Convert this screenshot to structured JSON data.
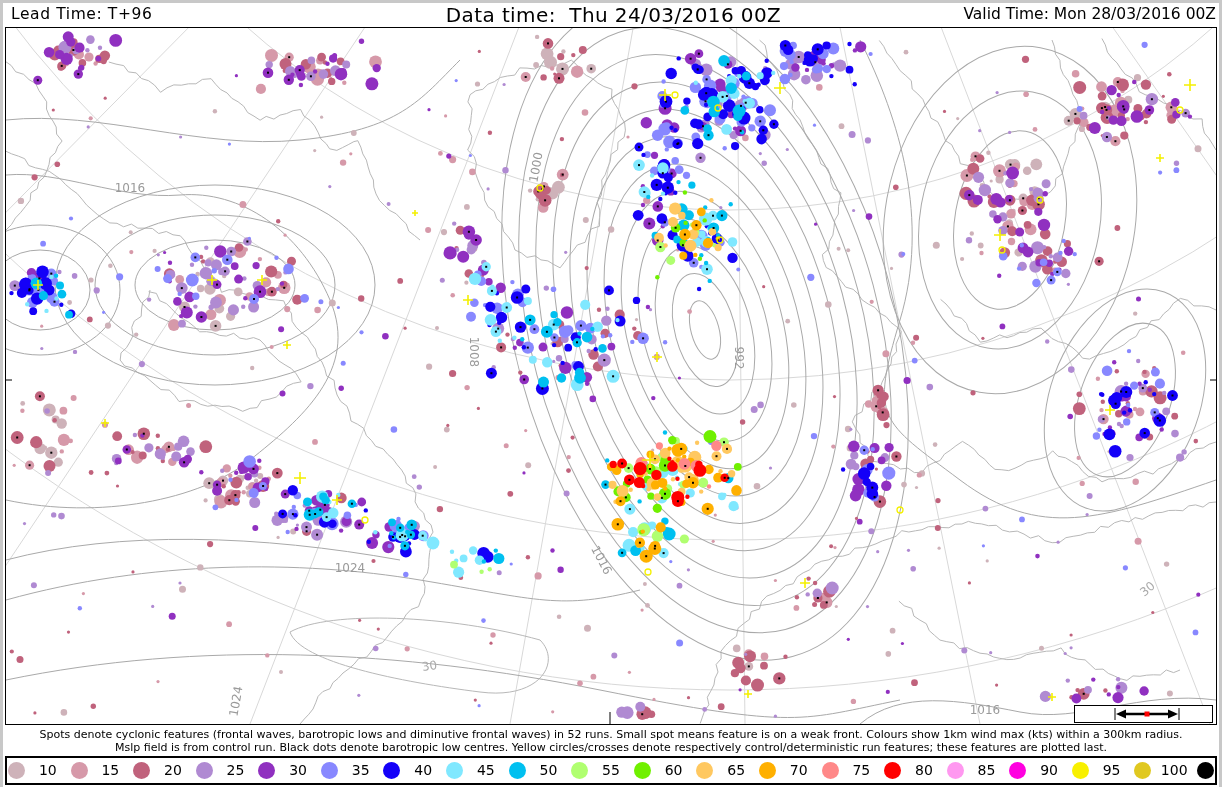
{
  "header": {
    "lead_time": "Lead Time: T+96",
    "data_time": "Data time:  Thu 24/03/2016 00Z",
    "valid_time": "Valid Time: Mon 28/03/2016 00Z"
  },
  "map": {
    "isobar_labels": [
      "1016",
      "1024",
      "1016",
      "1008",
      "1000",
      "992",
      "1016",
      "1024"
    ],
    "latitude_labels": [
      "30",
      "30"
    ]
  },
  "caption": [
    "Spots denote cyclonic features (frontal waves, barotropic lows and diminutive frontal waves) in 52 runs. Small spot means feature is on a weak front. Colours show 1km wind max (kts) within a 300km radius.",
    "Mslp field is from control run. Black dots denote barotropic low centres. Yellow circles/crosses denote respectively control/deterministic run features; these features are plotted last."
  ],
  "legend": [
    {
      "label": "10",
      "color": "#ceb2b9"
    },
    {
      "label": "15",
      "color": "#d699a9"
    },
    {
      "label": "20",
      "color": "#c0627c"
    },
    {
      "label": "25",
      "color": "#b08ad2"
    },
    {
      "label": "30",
      "color": "#9030c0"
    },
    {
      "label": "35",
      "color": "#8888ff"
    },
    {
      "label": "40",
      "color": "#1400f8"
    },
    {
      "label": "45",
      "color": "#80e8ff"
    },
    {
      "label": "50",
      "color": "#00c0f0"
    },
    {
      "label": "55",
      "color": "#b0ff70"
    },
    {
      "label": "60",
      "color": "#70f000"
    },
    {
      "label": "65",
      "color": "#ffc860"
    },
    {
      "label": "70",
      "color": "#ffb000"
    },
    {
      "label": "75",
      "color": "#ff8888"
    },
    {
      "label": "80",
      "color": "#ff0000"
    },
    {
      "label": "85",
      "color": "#ff98f0"
    },
    {
      "label": "90",
      "color": "#ff00e0"
    },
    {
      "label": "95",
      "color": "#f8f000"
    },
    {
      "label": "100",
      "color": "#e0c820"
    },
    {
      "color": "#000000"
    }
  ]
}
